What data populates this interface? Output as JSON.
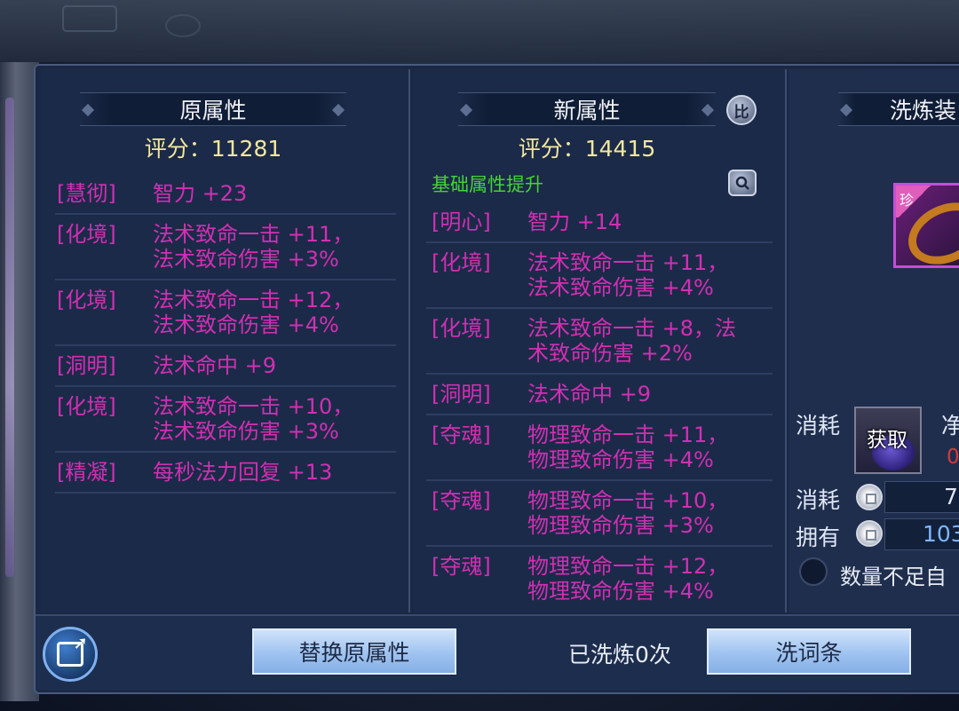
{
  "left": {
    "title": "原属性",
    "score": "评分：11281",
    "rows": [
      {
        "tag": "[慧彻]",
        "val": "智力 +23"
      },
      {
        "tag": "[化境]",
        "val": "法术致命一击 +11，\n法术致命伤害 +3%"
      },
      {
        "tag": "[化境]",
        "val": "法术致命一击 +12，\n法术致命伤害 +4%"
      },
      {
        "tag": "[洞明]",
        "val": "法术命中 +9"
      },
      {
        "tag": "[化境]",
        "val": "法术致命一击 +10，\n法术致命伤害 +3%"
      },
      {
        "tag": "[精凝]",
        "val": "每秒法力回复 +13"
      }
    ]
  },
  "mid": {
    "title": "新属性",
    "compare_label": "比",
    "score": "评分：14415",
    "note": "基础属性提升",
    "rows": [
      {
        "tag": "[明心]",
        "val": "智力 +14"
      },
      {
        "tag": "[化境]",
        "val": "法术致命一击 +11，\n法术致命伤害 +4%"
      },
      {
        "tag": "[化境]",
        "val": "法术致命一击 +8，法\n术致命伤害 +2%"
      },
      {
        "tag": "[洞明]",
        "val": "法术命中 +9"
      },
      {
        "tag": "[夺魂]",
        "val": "物理致命一击 +11，\n物理致命伤害 +4%"
      },
      {
        "tag": "[夺魂]",
        "val": "物理致命一击 +10，\n物理致命伤害 +3%"
      },
      {
        "tag": "[夺魂]",
        "val": "物理致命一击 +12，\n物理致命伤害 +4%"
      }
    ]
  },
  "right": {
    "title": "洗炼装",
    "item_badge": "珍",
    "cost_label_1": "消耗",
    "get_label": "获取",
    "material_name": "净",
    "material_count": "0",
    "cost_label_2": "消耗",
    "cost_value": "7",
    "own_label": "拥有",
    "own_value": "103",
    "auto_label": "数量不足自"
  },
  "footer": {
    "replace_button": "替换原属性",
    "wash_count": "已洗炼0次",
    "wash_button": "洗词条"
  },
  "icons": {
    "share": "share-icon",
    "compare": "compare-icon",
    "magnify": "magnify-icon"
  }
}
